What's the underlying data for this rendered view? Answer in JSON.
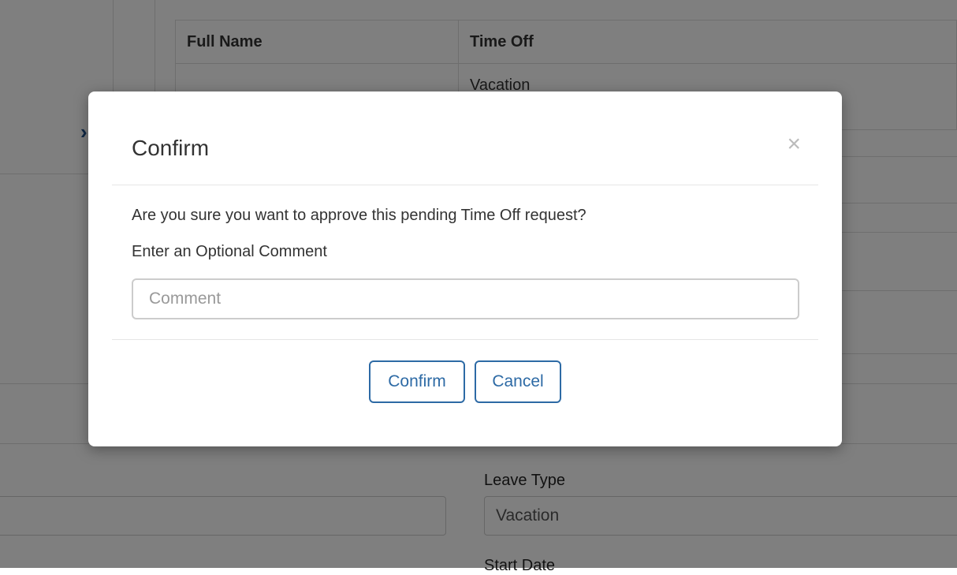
{
  "background": {
    "table": {
      "headers": [
        "Full Name",
        "Time Off"
      ],
      "first_row": {
        "full_name": "",
        "time_off": "Vacation"
      }
    },
    "form": {
      "leave_type_label": "Leave Type",
      "leave_type_value": "Vacation",
      "start_date_label": "Start Date"
    }
  },
  "modal": {
    "title": "Confirm",
    "close_symbol": "×",
    "question": "Are you sure you want to approve this pending Time Off request?",
    "comment_label": "Enter an Optional Comment",
    "comment_placeholder": "Comment",
    "comment_value": "",
    "confirm_label": "Confirm",
    "cancel_label": "Cancel"
  },
  "colors": {
    "accent": "#2d6aa5",
    "overlay": "rgba(0,0,0,0.5)"
  }
}
